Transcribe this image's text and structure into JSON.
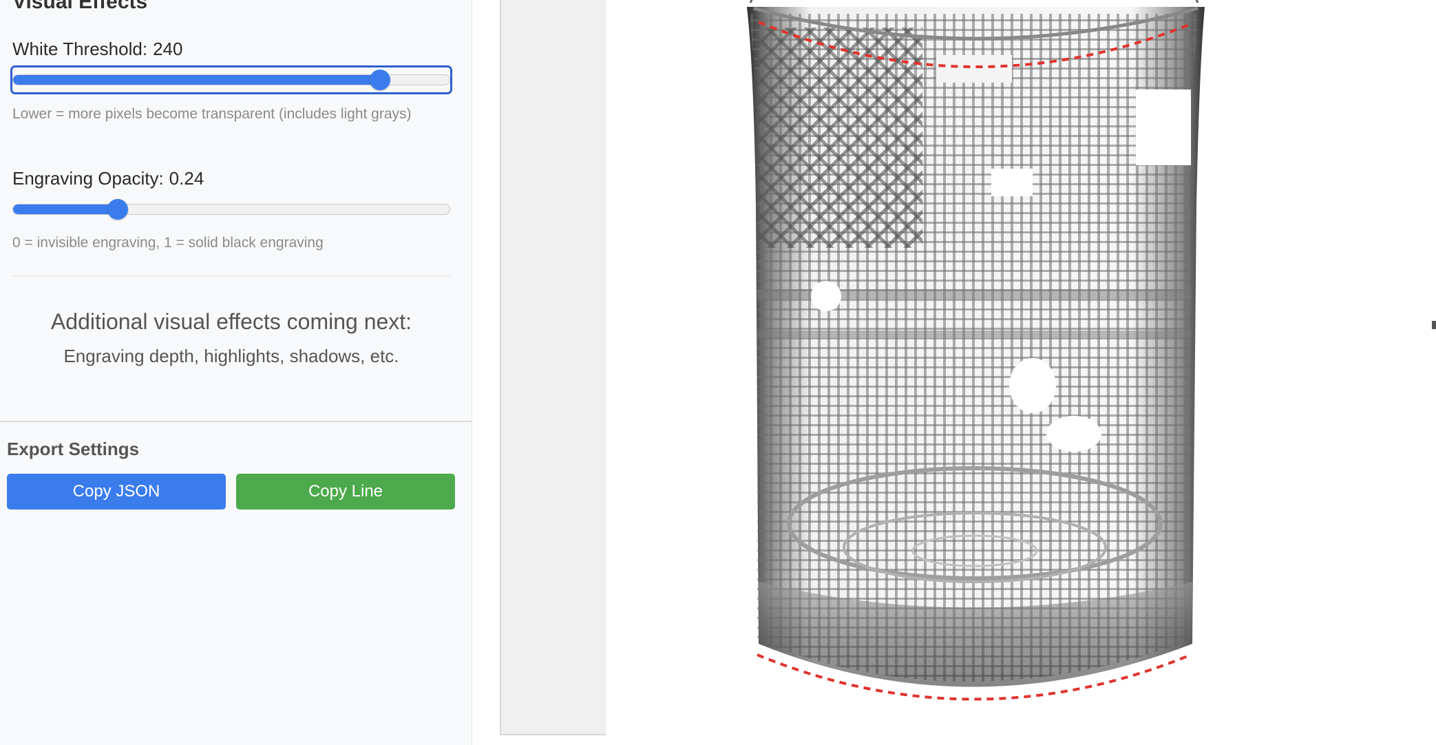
{
  "visual_effects": {
    "section_title": "Visual Effects",
    "white_threshold": {
      "label": "White Threshold:",
      "value": "240",
      "level": 0.84,
      "hint": "Lower = more pixels become transparent (includes light grays)"
    },
    "engraving_opacity": {
      "label": "Engraving Opacity:",
      "value": "0.24",
      "level": 0.24,
      "hint": "0 = invisible engraving, 1 = solid black engraving"
    },
    "coming_next": {
      "title": "Additional visual effects coming next:",
      "subtitle": "Engraving depth, highlights, shadows, etc."
    }
  },
  "export_settings": {
    "title": "Export Settings",
    "copy_json_label": "Copy JSON",
    "copy_line_label": "Copy Line"
  },
  "colors": {
    "accent_blue": "#3b7ced",
    "button_green": "#4caa4c",
    "guide_red": "#e0332d"
  }
}
